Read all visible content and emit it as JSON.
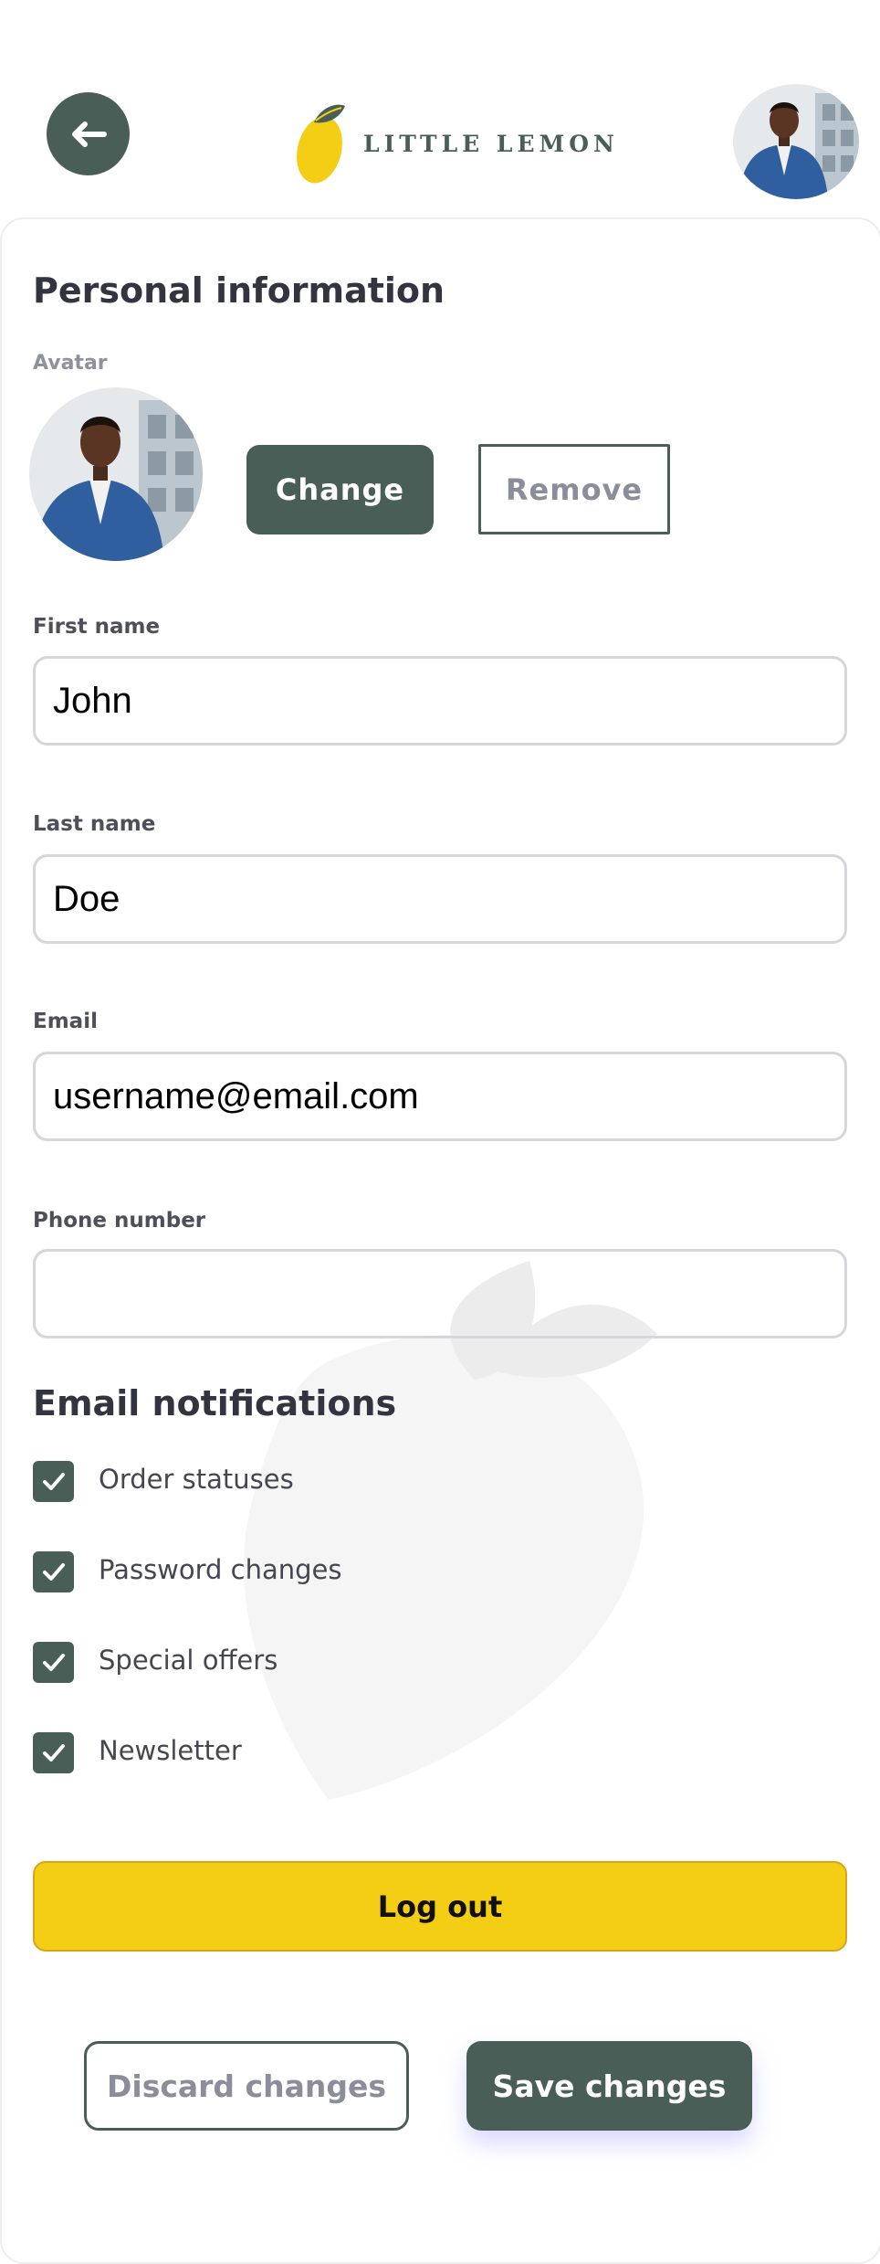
{
  "header": {
    "back_icon": "arrow-left-icon",
    "logo_text": "LITTLE LEMON",
    "logo_icon": "lemon-icon",
    "profile_avatar_icon": "person-photo"
  },
  "profile": {
    "section_title": "Personal information",
    "avatar_label": "Avatar",
    "change_label": "Change",
    "remove_label": "Remove",
    "fields": {
      "first_name": {
        "label": "First name",
        "value": "John"
      },
      "last_name": {
        "label": "Last name",
        "value": "Doe"
      },
      "email": {
        "label": "Email",
        "value": "username@email.com"
      },
      "phone": {
        "label": "Phone number",
        "value": ""
      }
    }
  },
  "notifications": {
    "section_title": "Email notifications",
    "items": [
      {
        "label": "Order statuses",
        "checked": true
      },
      {
        "label": "Password changes",
        "checked": true
      },
      {
        "label": "Special offers",
        "checked": true
      },
      {
        "label": "Newsletter",
        "checked": true
      }
    ]
  },
  "actions": {
    "logout_label": "Log out",
    "discard_label": "Discard changes",
    "save_label": "Save changes"
  },
  "colors": {
    "primary_green": "#495e57",
    "lemon_yellow": "#f4ce14",
    "text_dark": "#33343f",
    "muted_text": "#8b8d9b",
    "input_border": "#d5d6d9"
  }
}
